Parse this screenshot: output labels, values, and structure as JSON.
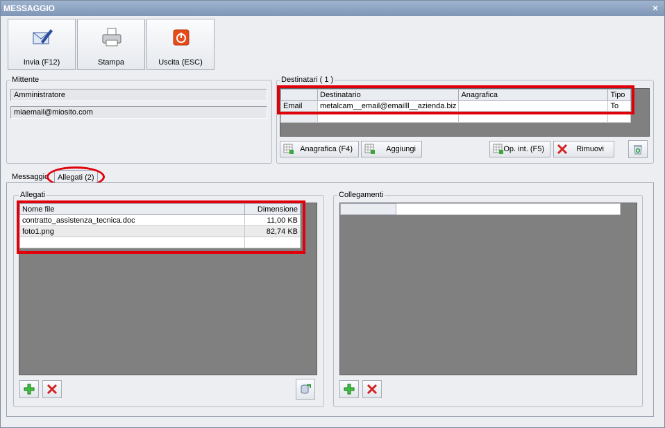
{
  "window": {
    "title": "MESSAGGIO",
    "close_glyph": "×"
  },
  "toolbar": {
    "send_label": "Invia (F12)",
    "print_label": "Stampa",
    "exit_label": "Uscita (ESC)"
  },
  "sender": {
    "group_label": "Mittente",
    "name": "Amministratore",
    "email": "miaemail@miosito.com"
  },
  "recipients": {
    "group_label": "Destinatari ( 1 )",
    "columns": [
      "Destinatario",
      "Anagrafica",
      "Tipo"
    ],
    "rows": [
      {
        "row_header": "Email",
        "recipient": "metalcam__email@emailll__azienda.biz",
        "registry": "",
        "type": "To"
      }
    ],
    "btn_registry": "Anagrafica (F4)",
    "btn_add": "Aggiungi",
    "btn_internal": "Op. int. (F5)",
    "btn_remove": "Rimuovi"
  },
  "tabs": [
    {
      "label": "Messaggio"
    },
    {
      "label": "Allegati (2)"
    }
  ],
  "attachments": {
    "group_label": "Allegati",
    "columns": [
      "Nome file",
      "Dimensione"
    ],
    "rows": [
      {
        "name": "contratto_assistenza_tecnica.doc",
        "size": "11,00 KB"
      },
      {
        "name": "foto1.png",
        "size": "82,74 KB"
      }
    ]
  },
  "links": {
    "group_label": "Collegamenti"
  },
  "colors": {
    "highlight": "#e0000a",
    "grid_bg": "#808080",
    "title_bar": "#8fa5c3"
  }
}
